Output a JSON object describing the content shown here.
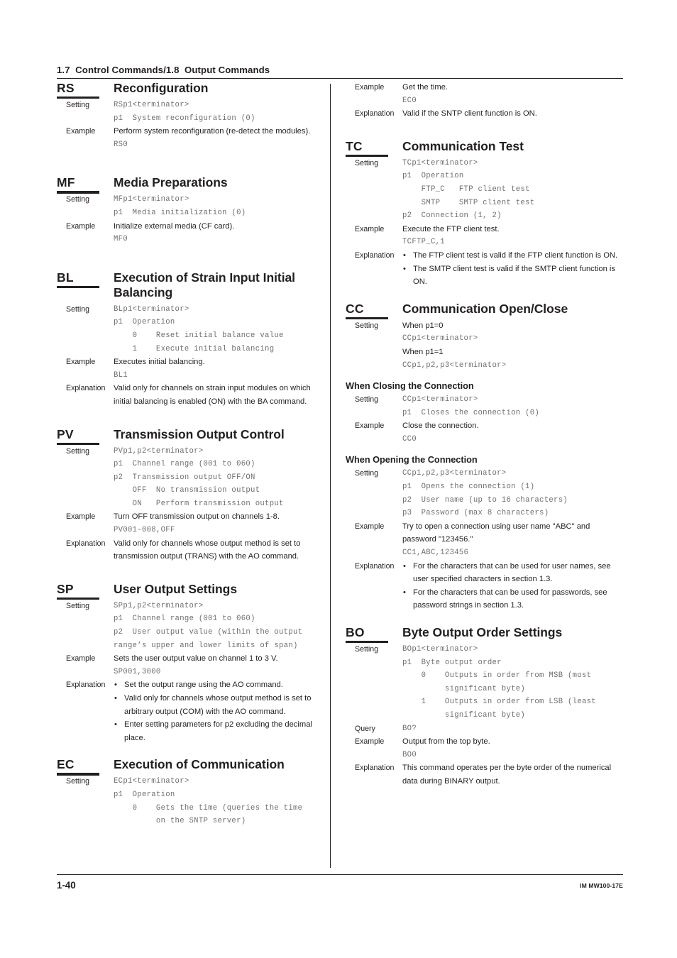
{
  "header": {
    "running_head": "1.7  Control Commands/1.8  Output Commands"
  },
  "footer": {
    "page_number": "1-40",
    "document_number": "IM MW100-17E"
  },
  "labels": {
    "setting": "Setting",
    "example": "Example",
    "explanation": "Explanation",
    "query": "Query",
    "bullet": "•"
  },
  "left_column": {
    "rs": {
      "code": "RS",
      "title": "Reconfiguration",
      "setting_syntax": "RSp1<terminator>",
      "setting_p1": "p1  System reconfiguration (0)",
      "example_text": "Perform system reconfiguration (re-detect the modules).",
      "example_code": "RS0"
    },
    "mf": {
      "code": "MF",
      "title": "Media Preparations",
      "setting_syntax": "MFp1<terminator>",
      "setting_p1": "p1  Media initialization (0)",
      "example_text": "Initialize external media (CF card).",
      "example_code": "MF0"
    },
    "bl": {
      "code": "BL",
      "title": "Execution of Strain Input Initial Balancing",
      "setting_syntax": "BLp1<terminator>",
      "setting_p1": "p1  Operation",
      "setting_p1_opt0": "    0    Reset initial balance value",
      "setting_p1_opt1": "    1    Execute initial balancing",
      "example_text": "Executes initial balancing.",
      "example_code": "BL1",
      "explanation_text": "Valid only for channels on strain input modules on which initial balancing is enabled (ON) with the BA command."
    },
    "pv": {
      "code": "PV",
      "title": "Transmission Output Control",
      "setting_syntax": "PVp1,p2<terminator>",
      "setting_p1": "p1  Channel range (001 to 060)",
      "setting_p2": "p2  Transmission output OFF/ON",
      "setting_p2_off": "    OFF  No transmission output",
      "setting_p2_on": "    ON   Perform transmission output",
      "example_text": "Turn OFF transmission output on channels 1-8.",
      "example_code": "PV001-008,OFF",
      "explanation_text": "Valid only for channels whose output method is set to transmission output (TRANS) with the AO command."
    },
    "sp": {
      "code": "SP",
      "title": "User Output Settings",
      "setting_syntax": "SPp1,p2<terminator>",
      "setting_p1": "p1  Channel range (001 to 060)",
      "setting_p2_line1": "p2  User output value (within the output",
      "setting_p2_line2": "range’s upper and lower limits of span)",
      "example_text": "Sets the user output value on channel 1 to 3 V.",
      "example_code": "SP001,3000",
      "explanation_bullets": [
        "Set the output range using the AO command.",
        "Valid only for channels whose output method is set to arbitrary output (COM) with the AO command.",
        "Enter setting parameters for p2 excluding the decimal place."
      ]
    },
    "ec": {
      "code": "EC",
      "title": "Execution of Communication",
      "setting_syntax": "ECp1<terminator>",
      "setting_p1": "p1  Operation",
      "setting_p1_opt0_line1": "    0    Gets the time (queries the time",
      "setting_p1_opt0_line2": "         on the SNTP server)"
    }
  },
  "right_column": {
    "ec_continued": {
      "example_text": "Get the time.",
      "example_code": "EC0",
      "explanation_text": "Valid if the SNTP client function is ON."
    },
    "tc": {
      "code": "TC",
      "title": "Communication Test",
      "setting_syntax": "TCp1<terminator>",
      "setting_p1": "p1  Operation",
      "setting_p1_ftp": "    FTP_C   FTP client test",
      "setting_p1_smtp": "    SMTP    SMTP client test",
      "setting_p2": "p2  Connection (1, 2)",
      "example_text": "Execute the FTP client test.",
      "example_code": "TCFTP_C,1",
      "explanation_bullets": [
        "The FTP client test is valid if the FTP client function is ON.",
        "The SMTP client test is valid if the SMTP client function is ON."
      ]
    },
    "cc": {
      "code": "CC",
      "title": "Communication Open/Close",
      "setting_when_p1_0": "When p1=0",
      "setting_syntax_0": "CCp1<terminator>",
      "setting_when_p1_1": "When p1=1",
      "setting_syntax_1": "CCp1,p2,p3<terminator>",
      "closing": {
        "heading": "When Closing the Connection",
        "setting_syntax": "CCp1<terminator>",
        "setting_p1": "p1  Closes the connection (0)",
        "example_text": "Close the connection.",
        "example_code": "CC0"
      },
      "opening": {
        "heading": "When Opening the Connection",
        "setting_syntax": "CCp1,p2,p3<terminator>",
        "setting_p1": "p1  Opens the connection (1)",
        "setting_p2": "p2  User name (up to 16 characters)",
        "setting_p3": "p3  Password (max 8 characters)",
        "example_text": "Try to open a connection using user name \"ABC\" and password \"123456.\"",
        "example_code": "CC1,ABC,123456",
        "explanation_bullets": [
          "For the characters that can be used for user names, see user specified characters in section 1.3.",
          "For the characters that can be used for passwords, see password strings in section 1.3."
        ]
      }
    },
    "bo": {
      "code": "BO",
      "title": "Byte Output Order Settings",
      "setting_syntax": "BOp1<terminator>",
      "setting_p1": "p1  Byte output order",
      "setting_p1_opt0_line1": "    0    Outputs in order from MSB (most",
      "setting_p1_opt0_line2": "         significant byte)",
      "setting_p1_opt1_line1": "    1    Outputs in order from LSB (least",
      "setting_p1_opt1_line2": "         significant byte)",
      "query_code": "BO?",
      "example_text": "Output from the top byte.",
      "example_code": "BO0",
      "explanation_text": "This command operates per the byte order of the numerical data during BINARY output."
    }
  }
}
